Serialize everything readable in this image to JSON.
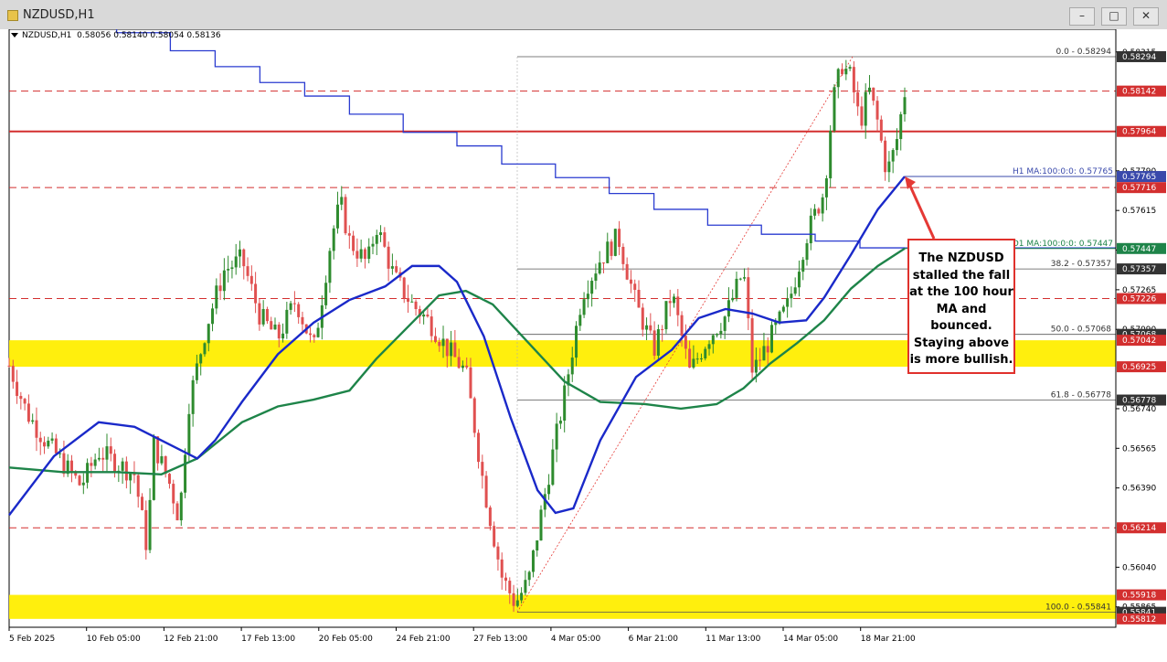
{
  "window": {
    "title": "NZDUSD,H1",
    "buttons": [
      "–",
      "□",
      "✕"
    ]
  },
  "header": {
    "symbol": "NZDUSD,H1",
    "values": "0.58056 0.58140 0.58054 0.58136"
  },
  "annotation": {
    "text": "The NZDUSD stalled the fall at the 100 hour MA and bounced. Staying above is more bullish."
  },
  "chart_data": {
    "type": "candlestick",
    "symbol": "NZDUSD",
    "timeframe": "H1",
    "y_axis_ticks": [
      "0.58315",
      "0.57790",
      "0.57615",
      "0.57440",
      "0.57265",
      "0.57090",
      "0.56740",
      "0.56565",
      "0.56390",
      "0.56040",
      "0.55865"
    ],
    "x_axis_ticks": [
      "5 Feb 2025",
      "10 Feb 05:00",
      "12 Feb 21:00",
      "17 Feb 13:00",
      "20 Feb 05:00",
      "24 Feb 21:00",
      "27 Feb 13:00",
      "4 Mar 05:00",
      "6 Mar 21:00",
      "11 Mar 13:00",
      "14 Mar 05:00",
      "18 Mar 21:00"
    ],
    "price_labels": [
      {
        "value": "0.58294",
        "color": "#333333"
      },
      {
        "value": "0.58142",
        "color": "#d32f2f"
      },
      {
        "value": "0.57964",
        "color": "#d32f2f"
      },
      {
        "value": "0.57765",
        "color": "#3949ab"
      },
      {
        "value": "0.57716",
        "color": "#d32f2f"
      },
      {
        "value": "0.57447",
        "color": "#1e8449"
      },
      {
        "value": "0.57357",
        "color": "#333333"
      },
      {
        "value": "0.57226",
        "color": "#d32f2f"
      },
      {
        "value": "0.57068",
        "color": "#333333"
      },
      {
        "value": "0.57042",
        "color": "#d32f2f"
      },
      {
        "value": "0.56925",
        "color": "#d32f2f"
      },
      {
        "value": "0.56778",
        "color": "#333333"
      },
      {
        "value": "0.56214",
        "color": "#d32f2f"
      },
      {
        "value": "0.55918",
        "color": "#d32f2f"
      },
      {
        "value": "0.55841",
        "color": "#333333"
      },
      {
        "value": "0.55812",
        "color": "#d32f2f"
      }
    ],
    "levels": {
      "red_dashed": [
        0.58142,
        0.57716,
        0.57226,
        0.56214
      ],
      "red_solid": [
        0.57964
      ]
    },
    "zones": [
      {
        "from": 0.56925,
        "to": 0.57042,
        "color": "#ffee00"
      },
      {
        "from": 0.55812,
        "to": 0.55918,
        "color": "#ffee00"
      }
    ],
    "fibonacci": [
      {
        "label": "0.0 - 0.58294",
        "value": 0.58294
      },
      {
        "label": "38.2 - 0.57357",
        "value": 0.57357
      },
      {
        "label": "50.0 - 0.57068",
        "value": 0.57068
      },
      {
        "label": "61.8 - 0.56778",
        "value": 0.56778
      },
      {
        "label": "100.0 - 0.55841",
        "value": 0.55841
      }
    ],
    "ma_labels": [
      {
        "text": "H1 MA:100:0:0: 0.57765",
        "value": 0.57765,
        "color": "#3949ab"
      },
      {
        "text": "D1 MA:100:0:0: 0.57447",
        "value": 0.57447,
        "color": "#1e8449"
      }
    ],
    "series": [
      {
        "name": "H1 MA:100",
        "color": "#1a29c9",
        "points": [
          [
            0,
            0.5627
          ],
          [
            0.05,
            0.5653
          ],
          [
            0.1,
            0.5668
          ],
          [
            0.14,
            0.5666
          ],
          [
            0.18,
            0.5658
          ],
          [
            0.21,
            0.5652
          ],
          [
            0.23,
            0.566
          ],
          [
            0.26,
            0.5677
          ],
          [
            0.3,
            0.5698
          ],
          [
            0.34,
            0.5712
          ],
          [
            0.38,
            0.5722
          ],
          [
            0.42,
            0.5728
          ],
          [
            0.45,
            0.5737
          ],
          [
            0.48,
            0.5737
          ],
          [
            0.5,
            0.573
          ],
          [
            0.53,
            0.5706
          ],
          [
            0.56,
            0.567
          ],
          [
            0.59,
            0.5638
          ],
          [
            0.61,
            0.5628
          ],
          [
            0.63,
            0.563
          ],
          [
            0.66,
            0.566
          ],
          [
            0.7,
            0.5688
          ],
          [
            0.74,
            0.57
          ],
          [
            0.77,
            0.5714
          ],
          [
            0.8,
            0.5718
          ],
          [
            0.83,
            0.5716
          ],
          [
            0.86,
            0.5712
          ],
          [
            0.89,
            0.5713
          ],
          [
            0.91,
            0.5723
          ],
          [
            0.94,
            0.5742
          ],
          [
            0.97,
            0.5762
          ],
          [
            1.0,
            0.57765
          ]
        ]
      },
      {
        "name": "D1 MA:100",
        "color": "#1e8449",
        "points": [
          [
            0,
            0.5648
          ],
          [
            0.06,
            0.5646
          ],
          [
            0.12,
            0.5646
          ],
          [
            0.17,
            0.5645
          ],
          [
            0.21,
            0.5652
          ],
          [
            0.26,
            0.5668
          ],
          [
            0.3,
            0.5675
          ],
          [
            0.34,
            0.5678
          ],
          [
            0.38,
            0.5682
          ],
          [
            0.41,
            0.5696
          ],
          [
            0.45,
            0.5712
          ],
          [
            0.48,
            0.5724
          ],
          [
            0.51,
            0.5726
          ],
          [
            0.54,
            0.572
          ],
          [
            0.58,
            0.5703
          ],
          [
            0.62,
            0.5686
          ],
          [
            0.66,
            0.5677
          ],
          [
            0.71,
            0.5676
          ],
          [
            0.75,
            0.5674
          ],
          [
            0.79,
            0.5676
          ],
          [
            0.82,
            0.5683
          ],
          [
            0.85,
            0.5694
          ],
          [
            0.88,
            0.5703
          ],
          [
            0.91,
            0.5713
          ],
          [
            0.94,
            0.5727
          ],
          [
            0.97,
            0.5737
          ],
          [
            1.0,
            0.57447
          ]
        ]
      },
      {
        "name": "D1 MA:100 step",
        "color": "#2a3bd0",
        "points": [
          [
            0.0,
            0.5857
          ],
          [
            0.06,
            0.5852
          ],
          [
            0.12,
            0.584
          ],
          [
            0.18,
            0.5832
          ],
          [
            0.23,
            0.5825
          ],
          [
            0.28,
            0.5818
          ],
          [
            0.33,
            0.5812
          ],
          [
            0.38,
            0.5804
          ],
          [
            0.44,
            0.5796
          ],
          [
            0.5,
            0.579
          ],
          [
            0.55,
            0.5782
          ],
          [
            0.61,
            0.5776
          ],
          [
            0.67,
            0.5769
          ],
          [
            0.72,
            0.5762
          ],
          [
            0.78,
            0.5755
          ],
          [
            0.84,
            0.5751
          ],
          [
            0.9,
            0.5748
          ],
          [
            0.95,
            0.5745
          ],
          [
            1.0,
            0.5745
          ]
        ]
      },
      {
        "name": "Price",
        "color": "#555555",
        "points": [
          [
            0,
            0.5693
          ],
          [
            0.02,
            0.5672
          ],
          [
            0.04,
            0.566
          ],
          [
            0.06,
            0.565
          ],
          [
            0.08,
            0.564
          ],
          [
            0.1,
            0.5655
          ],
          [
            0.12,
            0.565
          ],
          [
            0.14,
            0.5645
          ],
          [
            0.155,
            0.561
          ],
          [
            0.16,
            0.566
          ],
          [
            0.18,
            0.564
          ],
          [
            0.19,
            0.5625
          ],
          [
            0.2,
            0.5675
          ],
          [
            0.22,
            0.571
          ],
          [
            0.24,
            0.5735
          ],
          [
            0.26,
            0.574
          ],
          [
            0.28,
            0.5715
          ],
          [
            0.3,
            0.5705
          ],
          [
            0.32,
            0.5722
          ],
          [
            0.34,
            0.57
          ],
          [
            0.36,
            0.575
          ],
          [
            0.37,
            0.5765
          ],
          [
            0.38,
            0.5748
          ],
          [
            0.4,
            0.5738
          ],
          [
            0.41,
            0.5755
          ],
          [
            0.43,
            0.5732
          ],
          [
            0.45,
            0.572
          ],
          [
            0.47,
            0.5712
          ],
          [
            0.49,
            0.57
          ],
          [
            0.51,
            0.569
          ],
          [
            0.53,
            0.564
          ],
          [
            0.55,
            0.56
          ],
          [
            0.565,
            0.5588
          ],
          [
            0.58,
            0.5598
          ],
          [
            0.6,
            0.564
          ],
          [
            0.62,
            0.568
          ],
          [
            0.64,
            0.5725
          ],
          [
            0.66,
            0.574
          ],
          [
            0.68,
            0.575
          ],
          [
            0.7,
            0.572
          ],
          [
            0.72,
            0.57
          ],
          [
            0.74,
            0.5725
          ],
          [
            0.76,
            0.569
          ],
          [
            0.78,
            0.5705
          ],
          [
            0.8,
            0.5715
          ],
          [
            0.82,
            0.5735
          ],
          [
            0.83,
            0.569
          ],
          [
            0.85,
            0.5705
          ],
          [
            0.87,
            0.572
          ],
          [
            0.89,
            0.575
          ],
          [
            0.91,
            0.577
          ],
          [
            0.92,
            0.581
          ],
          [
            0.93,
            0.5826
          ],
          [
            0.94,
            0.582
          ],
          [
            0.95,
            0.58
          ],
          [
            0.96,
            0.5815
          ],
          [
            0.97,
            0.58
          ],
          [
            0.98,
            0.5778
          ],
          [
            0.99,
            0.579
          ],
          [
            1.0,
            0.58136
          ]
        ]
      }
    ],
    "ylim": [
      0.55775,
      0.58415
    ],
    "grid": false
  }
}
